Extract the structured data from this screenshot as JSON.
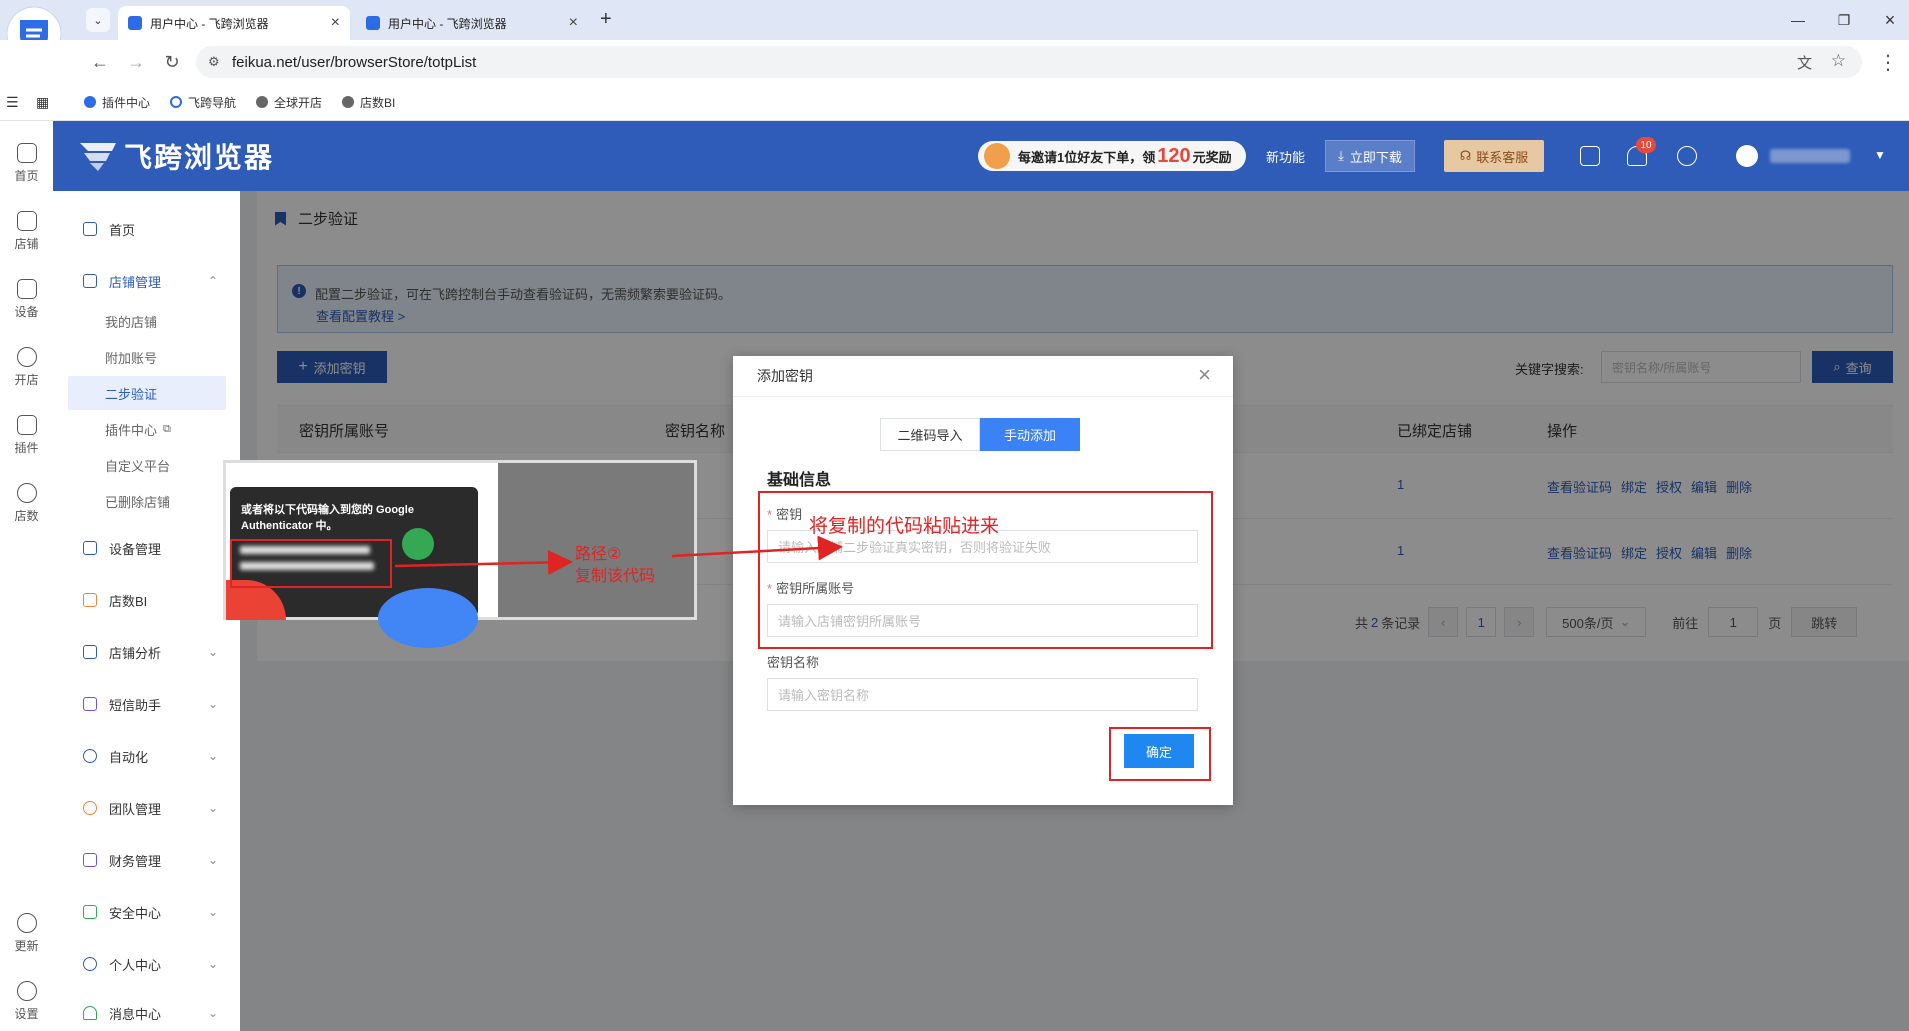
{
  "browser": {
    "tabs": [
      {
        "title": "用户中心 - 飞跨浏览器",
        "active": true
      },
      {
        "title": "用户中心 - 飞跨浏览器",
        "active": false
      }
    ],
    "url": "feikua.net/user/browserStore/totpList",
    "bookmarks": [
      "插件中心",
      "飞跨导航",
      "全球开店",
      "店数BI"
    ]
  },
  "rail": {
    "items": [
      "首页",
      "店铺",
      "设备",
      "开店",
      "插件",
      "店数",
      "更新",
      "设置"
    ]
  },
  "header": {
    "logo_text": "飞跨浏览器",
    "promo_prefix": "每邀请1位好友下单，领",
    "promo_amount": "120",
    "promo_suffix": "元奖励",
    "new_features": "新功能",
    "download": "立即下载",
    "contact": "联系客服",
    "notification_count": "10"
  },
  "sidebar": {
    "home": "首页",
    "store_mgmt": "店铺管理",
    "store_subs": [
      "我的店铺",
      "附加账号",
      "二步验证",
      "插件中心",
      "自定义平台",
      "已删除店铺"
    ],
    "groups": [
      "设备管理",
      "店数BI",
      "店铺分析",
      "短信助手",
      "自动化",
      "团队管理",
      "财务管理",
      "安全中心",
      "个人中心",
      "消息中心"
    ]
  },
  "main": {
    "breadcrumb": "二步验证",
    "notice_text": "配置二步验证，可在飞跨控制台手动查看验证码，无需频繁索要验证码。",
    "notice_link": "查看配置教程 >",
    "add_button": "添加密钥",
    "keyword_label": "关键字搜索:",
    "keyword_placeholder": "密钥名称/所属账号",
    "search_button": "查询",
    "columns": [
      "密钥所属账号",
      "密钥名称",
      "已绑定店铺",
      "操作"
    ],
    "rows": [
      {
        "bound": "1",
        "ops": [
          "查看验证码",
          "绑定",
          "授权",
          "编辑",
          "删除"
        ]
      },
      {
        "bound": "1",
        "ops": [
          "查看验证码",
          "绑定",
          "授权",
          "编辑",
          "删除"
        ]
      }
    ],
    "pager": {
      "total_prefix": "共",
      "total": "2",
      "total_suffix": "条记录",
      "page": "1",
      "page_size": "500条/页",
      "goto_label": "前往",
      "goto_value": "1",
      "page_unit": "页",
      "jump": "跳转"
    }
  },
  "modal": {
    "title": "添加密钥",
    "tab_qr": "二维码导入",
    "tab_manual": "手动添加",
    "section": "基础信息",
    "field_key_label": "密钥",
    "field_key_placeholder": "请输入店铺二步验证真实密钥，否则将验证失败",
    "field_account_label": "密钥所属账号",
    "field_account_placeholder": "请输入店铺密钥所属账号",
    "field_name_label": "密钥名称",
    "field_name_placeholder": "请输入密钥名称",
    "confirm": "确定"
  },
  "annotation": {
    "paste_hint": "将复制的代码粘贴进来",
    "path_label": "路径②",
    "copy_label": "复制该代码",
    "inset_text": "或者将以下代码输入到您的 Google Authenticator 中。"
  },
  "colors": {
    "brand": "#2e5cb8",
    "annotation_red": "#e02424",
    "confirm_blue": "#1e88f0"
  }
}
